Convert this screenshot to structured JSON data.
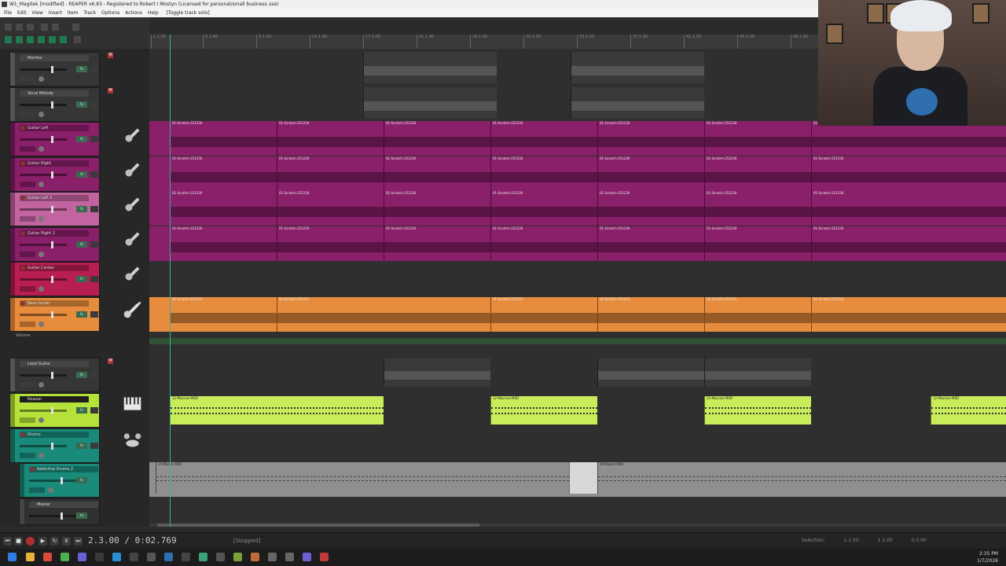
{
  "window": {
    "title": "W1_Magitek [modified] - REAPER v6.83 - Registered to Robert I Mostyn (Licensed for personal/small business use)"
  },
  "menu": {
    "items": [
      "File",
      "Edit",
      "View",
      "Insert",
      "Item",
      "Track",
      "Options",
      "Actions",
      "Help"
    ],
    "toggle_label": "[Toggle track solo]"
  },
  "ruler": {
    "marks": [
      "1.1.00",
      "5.1.00",
      "9.1.00",
      "13.1.00",
      "17.1.00",
      "21.1.00",
      "25.1.00",
      "29.1.00",
      "33.1.00",
      "37.1.00",
      "41.1.00",
      "45.1.00",
      "49.1.00"
    ]
  },
  "tracks": [
    {
      "name": "Monitor",
      "color": "#3b3b3b",
      "armed": true
    },
    {
      "name": "Vocal Melody",
      "color": "#3b3b3b",
      "armed": true
    },
    {
      "name": "Guitar Left",
      "color": "#8a1f6a",
      "armed": false
    },
    {
      "name": "Guitar Right",
      "color": "#8a1f6a",
      "armed": false
    },
    {
      "name": "Guitar Left 2",
      "color": "#c2649f",
      "armed": false
    },
    {
      "name": "Guitar Right 2",
      "color": "#8a1f6a",
      "armed": false
    },
    {
      "name": "Guitar Center",
      "color": "#b81e52",
      "armed": false
    },
    {
      "name": "Bass Guitar",
      "color": "#e68c3c",
      "armed": false
    },
    {
      "name": "Lead Guitar",
      "color": "#3b3b3b",
      "armed": true
    },
    {
      "name": "Reason",
      "color": "#b5e23a",
      "armed": false
    },
    {
      "name": "Drums",
      "color": "#1a8a7a",
      "armed": false
    },
    {
      "name": "Addictive Drums 2",
      "color": "#1a8a7a",
      "armed": false
    },
    {
      "name": "Master",
      "color": "#2f2f2f",
      "armed": false
    }
  ],
  "envelope": {
    "label": "Volume"
  },
  "items": {
    "guitar_file_prefix": "01-Scratch-251230",
    "bass_file_prefix": "01-Scratch-251231",
    "midi_label": "12-Massive-MIDI",
    "drums_label": "19-Master-MIDI"
  },
  "transport": {
    "time": "2.3.00 / 0:02.769",
    "status": "[Stopped]",
    "selection_label": "Selection:",
    "selection_values": [
      "1.1.00",
      "1.1.00",
      "0.0.00"
    ]
  },
  "taskbar": {
    "time": "2:35 PM",
    "date": "1/7/2026"
  },
  "colors": {
    "guitar": "#8a1f6a",
    "bass": "#e68c3c",
    "midi": "#c8ec5a",
    "drums": "#8f8f8f",
    "cursor": "#3bb09a"
  }
}
